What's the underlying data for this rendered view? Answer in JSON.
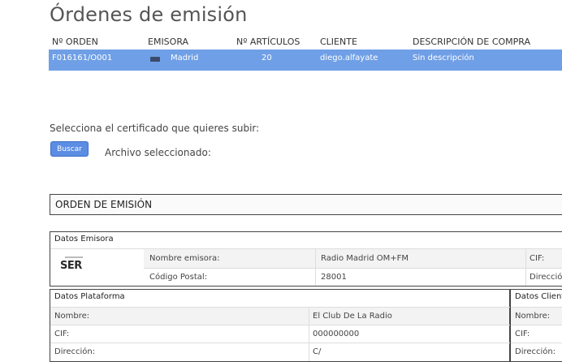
{
  "page": {
    "title": "Órdenes de emisión"
  },
  "orders_table": {
    "columns": [
      "Nº ORDEN",
      "EMISORA",
      "Nº ARTÍCULOS",
      "CLIENTE",
      "DESCRIPCIÓN DE COMPRA"
    ],
    "rows": [
      {
        "orden": "F016161/O001",
        "emisora": "Madrid",
        "articulos": "20",
        "cliente": "diego.alfayate",
        "descripcion": "Sin descripción",
        "logo_icon": "ser-logo-icon"
      }
    ],
    "selected_row_color": "#6f9fe6"
  },
  "upload": {
    "label": "Selecciona el certificado que quieres subir:",
    "button_label": "Buscar",
    "selected_file_label": "Archivo seleccionado:"
  },
  "order_detail": {
    "title": "ORDEN DE EMISIÓN",
    "emisora": {
      "header": "Datos Emisora",
      "logo_text": "SER",
      "fields": [
        {
          "label": "Nombre emisora:",
          "value": "Radio Madrid OM+FM"
        },
        {
          "label": "Código Postal:",
          "value": "28001"
        }
      ],
      "right_labels": [
        "CIF:",
        "Direcció"
      ]
    },
    "plataforma": {
      "header": "Datos Plataforma",
      "fields": [
        {
          "label": "Nombre:",
          "value": "El Club De La Radio"
        },
        {
          "label": "CIF:",
          "value": "000000000"
        },
        {
          "label": "Dirección:",
          "value": "C/"
        }
      ]
    },
    "cliente": {
      "header": "Datos Client",
      "fields": [
        {
          "label": "Nombre:"
        },
        {
          "label": "CIF:"
        },
        {
          "label": "Dirección:"
        }
      ]
    }
  }
}
